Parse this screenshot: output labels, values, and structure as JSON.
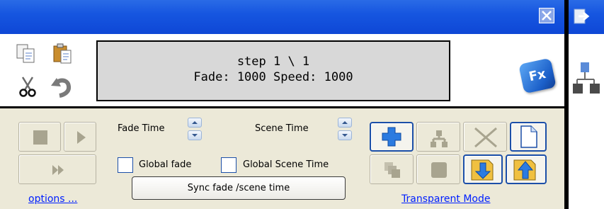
{
  "display": {
    "line1": "step 1 \\ 1",
    "line2": "Fade: 1000  Speed: 1000"
  },
  "fx_badge": "Fx",
  "labels": {
    "fade_time": "Fade Time",
    "scene_time": "Scene Time",
    "global_fade": "Global fade",
    "global_scene_time": "Global Scene Time"
  },
  "checkboxes": {
    "global_fade": false,
    "global_scene_time": false
  },
  "buttons": {
    "sync": "Sync fade /scene time"
  },
  "links": {
    "options": "options ...",
    "transparent_mode": "Transparent Mode"
  },
  "icons": {
    "copy": "copy-icon",
    "paste": "paste-icon",
    "cut": "cut-icon",
    "undo": "undo-icon",
    "fx": "fx-icon",
    "stop": "stop-icon",
    "play": "play-icon",
    "fast_forward": "fast-forward-icon",
    "add": "add-icon",
    "hierarchy": "hierarchy-icon",
    "delete": "delete-icon",
    "new_page": "new-page-icon",
    "stack": "stack-icon",
    "record": "record-icon",
    "import": "import-icon",
    "export": "export-icon",
    "close": "close-icon",
    "exit": "exit-icon",
    "network": "network-icon"
  },
  "colors": {
    "titlebar": "#1656e0",
    "link": "#0020ff",
    "accent": "#1c4fa8"
  }
}
